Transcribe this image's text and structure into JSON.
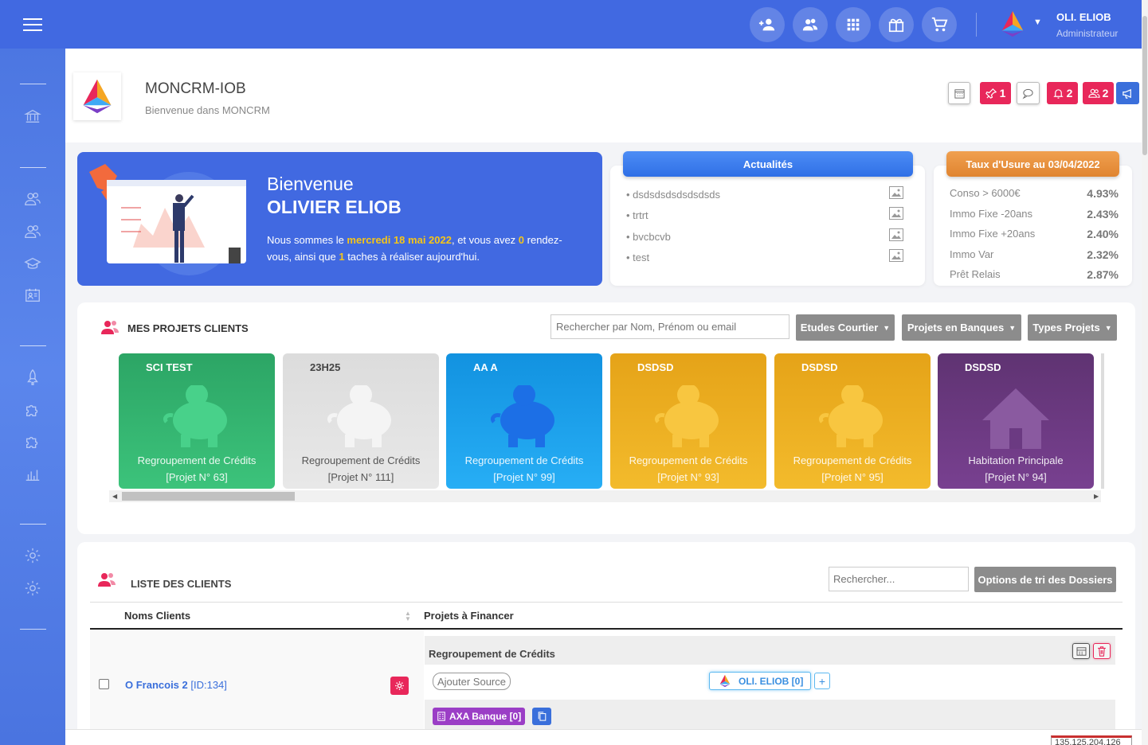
{
  "topbar": {
    "user_name": "OLI. ELIOB",
    "user_role": "Administrateur"
  },
  "header": {
    "app_title": "MONCRM-IOB",
    "app_subtitle": "Bienvenue dans MONCRM",
    "pin_count": "1",
    "bell_count": "2",
    "users_count": "2"
  },
  "welcome": {
    "hello": "Bienvenue",
    "name": "OLIVIER ELIOB",
    "text_1": "Nous sommes le ",
    "date": "mercredi 18 mai 2022",
    "text_2": ", et vous avez ",
    "rdv_count": "0",
    "text_3": " rendez-vous, ainsi que ",
    "task_count": "1",
    "text_4": " taches à réaliser aujourd'hui."
  },
  "news": {
    "title": "Actualités",
    "items": [
      "• dsdsdsdsdsdsdsds",
      "• trtrt",
      "• bvcbcvb",
      "• test"
    ]
  },
  "taux": {
    "title": "Taux d'Usure au 03/04/2022",
    "rows": [
      {
        "label": "Conso > 6000€",
        "value": "4.93%"
      },
      {
        "label": "Immo Fixe -20ans",
        "value": "2.43%"
      },
      {
        "label": "Immo Fixe +20ans",
        "value": "2.40%"
      },
      {
        "label": "Immo Var",
        "value": "2.32%"
      },
      {
        "label": "Prêt Relais",
        "value": "2.87%"
      }
    ]
  },
  "projects": {
    "title": "MES PROJETS CLIENTS",
    "search_placeholder": "Rechercher par Nom, Prénom ou email",
    "btn_etudes": "Etudes Courtier",
    "btn_banques": "Projets en Banques",
    "btn_types": "Types Projets",
    "cards": [
      {
        "name": "SCI TEST",
        "type": "Regroupement de Crédits",
        "num": "[Projet N° 63]"
      },
      {
        "name": "23H25",
        "type": "Regroupement de Crédits",
        "num": "[Projet N° 111]"
      },
      {
        "name": "AA A",
        "type": "Regroupement de Crédits",
        "num": "[Projet N° 99]"
      },
      {
        "name": "DSDSD",
        "type": "Regroupement de Crédits",
        "num": "[Projet N° 93]"
      },
      {
        "name": "DSDSD",
        "type": "Regroupement de Crédits",
        "num": "[Projet N° 95]"
      },
      {
        "name": "DSDSD",
        "type": "Habitation Principale",
        "num": "[Projet N° 94]"
      }
    ]
  },
  "clients": {
    "title": "LISTE DES CLIENTS",
    "search_placeholder": "Rechercher...",
    "btn_options": "Options de tri des Dossiers",
    "col_names": "Noms Clients",
    "col_projects": "Projets à Financer",
    "row": {
      "name": "O Francois 2",
      "id": " [ID:134]",
      "project_type": "Regroupement de Crédits",
      "add_source": "Ajouter Source",
      "agent": "OLI. ELIOB [0]",
      "plus": "+",
      "bank": "AXA Banque [0]"
    }
  },
  "footer": {
    "ip": "135.125.204.126"
  },
  "colors": {
    "primary": "#4169e1",
    "red": "#e8275a",
    "green": "#36b56e",
    "orange": "#e9a520",
    "purple": "#6b3a82"
  }
}
